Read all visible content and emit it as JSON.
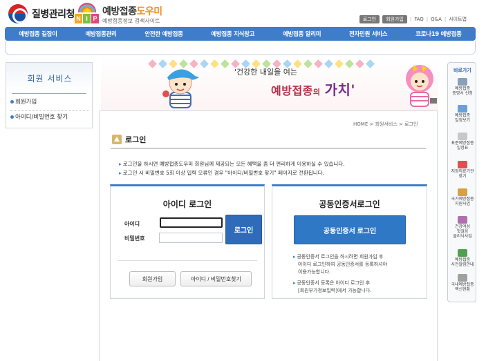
{
  "header": {
    "agency_name": "질병관리청",
    "logo_letters": [
      "N",
      "I",
      "P"
    ],
    "site_title_a": "예방접종",
    "site_title_b": "도우미",
    "site_subtitle": "예방접종정보 검색사이트",
    "util_links": {
      "login": "로그인",
      "join": "회원가입",
      "faq": "FAQ",
      "qna": "Q&A",
      "sitemap": "사이트맵"
    }
  },
  "gnb": {
    "items": [
      "예방접종 길잡이",
      "예방접종관리",
      "안전한 예방접종",
      "예방접종 지식창고",
      "예방접종 알리미",
      "전자민원 서비스",
      "코로나19 예방접종"
    ]
  },
  "lnb": {
    "title": "회원 서비스",
    "items": [
      "회원가입",
      "아이디/비밀번호 찾기"
    ]
  },
  "banner": {
    "slogan": "'건강한 내일을 여는",
    "slogan_main_a": "예방접종",
    "slogan_main_b": "의",
    "slogan_main_c": "가치'"
  },
  "breadcrumb": {
    "home": "HOME",
    "level1": "회원서비스",
    "level2": "로그인"
  },
  "section": {
    "title": "로그인",
    "notices": [
      "로그인을 하시면 예방접종도우미 회원님께 제공되는 모든 혜택을 좀 더 편리하게 이용하실 수 있습니다.",
      "로그인 시 비밀번호 5회 이상 입력 오류인 경우 \"아이디/비밀번호 찾기\" 페이지로 전환됩니다."
    ]
  },
  "id_login": {
    "title": "아이디 로그인",
    "id_label": "아이디",
    "pw_label": "비밀번호",
    "id_value": "",
    "pw_value": "",
    "login_button": "로그인",
    "join_button": "회원가입",
    "find_button": "아이디 / 비밀번호찾기"
  },
  "cert_login": {
    "title": "공동인증서로그인",
    "button": "공동인증서 로그인",
    "note1_line1": "공동인증서 로그인을 하시려면 회원가입 후",
    "note1_line2": "아이디 로그인하여 공동인증서를 등록하셔야",
    "note1_line3": "이용가능합니다.",
    "note2_line1": "공동인증서 등록은 아이디 로그인 후",
    "note2_line2": "[회원부가정보입력]에서 가능합니다."
  },
  "quick_menu": {
    "title": "바로가기",
    "items": [
      {
        "label": "예방접종\n증명서 신청",
        "icon": "printer-icon",
        "color": "#8aa0b8"
      },
      {
        "label": "예방접종\n일정보기",
        "icon": "calendar-icon",
        "color": "#6aa0d8"
      },
      {
        "label": "표준예방접종\n일정표",
        "icon": "document-icon",
        "color": "#c8c8c8"
      },
      {
        "label": "지정의료기관\n찾기",
        "icon": "hospital-icon",
        "color": "#e05050"
      },
      {
        "label": "국가예방접종\n지원사업",
        "icon": "form-icon",
        "color": "#d8a040"
      },
      {
        "label": "건강여성\n첫걸음\n클리닉사업",
        "icon": "clinic-icon",
        "color": "#b070b0"
      },
      {
        "label": "예방접종\n사전알림안내",
        "icon": "speaker-icon",
        "color": "#50a050"
      },
      {
        "label": "국내예방접종\n백신현황",
        "icon": "vaccine-icon",
        "color": "#a0a0a0"
      }
    ]
  }
}
